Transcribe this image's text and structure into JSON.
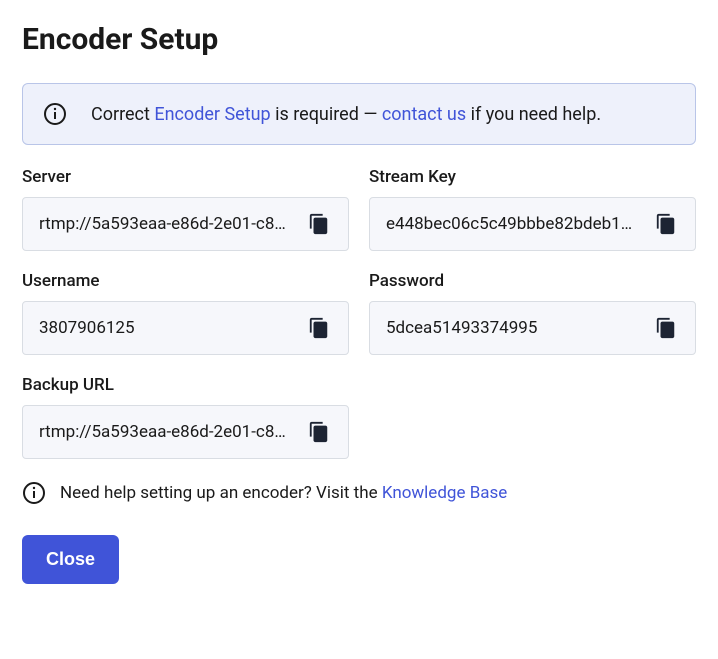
{
  "title": "Encoder Setup",
  "alert": {
    "prefix": "Correct ",
    "link1": "Encoder Setup",
    "middle": " is required — ",
    "link2": "contact us",
    "suffix": " if you need help."
  },
  "fields": {
    "server": {
      "label": "Server",
      "value": "rtmp://5a593eaa-e86d-2e01-c8…"
    },
    "stream_key": {
      "label": "Stream Key",
      "value": "e448bec06c5c49bbbe82bdeb1…"
    },
    "username": {
      "label": "Username",
      "value": "3807906125"
    },
    "password": {
      "label": "Password",
      "value": "5dcea51493374995"
    },
    "backup_url": {
      "label": "Backup URL",
      "value": "rtmp://5a593eaa-e86d-2e01-c8…"
    }
  },
  "help": {
    "text": "Need help setting up an encoder? Visit the ",
    "link": "Knowledge Base"
  },
  "buttons": {
    "close": "Close"
  }
}
